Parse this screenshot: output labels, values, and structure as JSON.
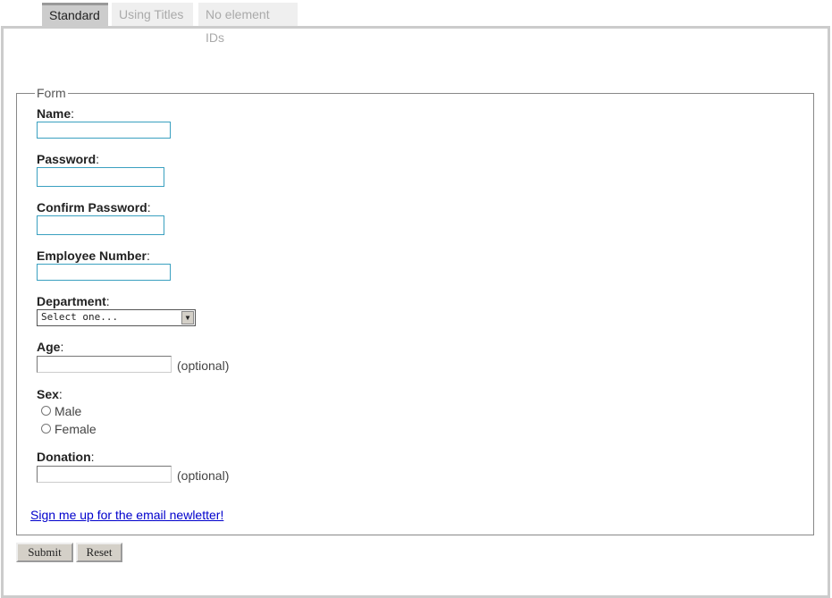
{
  "tabs": [
    {
      "label": "Standard",
      "active": true
    },
    {
      "label": "Using Titles"
    },
    {
      "label": "No element IDs"
    }
  ],
  "form": {
    "legend": "Form",
    "fields": {
      "name": {
        "label": "Name",
        "value": ""
      },
      "password": {
        "label": "Password",
        "value": ""
      },
      "confirm_password": {
        "label": "Confirm Password",
        "value": ""
      },
      "employee_number": {
        "label": "Employee Number",
        "value": ""
      },
      "department": {
        "label": "Department",
        "selected": "Select one..."
      },
      "age": {
        "label": "Age",
        "value": "",
        "note": "(optional)"
      },
      "sex": {
        "label": "Sex",
        "options": [
          "Male",
          "Female"
        ]
      },
      "donation": {
        "label": "Donation",
        "value": "",
        "note": "(optional)"
      }
    },
    "colon": ":",
    "newsletter_link": "Sign me up for the email newletter!",
    "submit": "Submit",
    "reset": "Reset"
  }
}
